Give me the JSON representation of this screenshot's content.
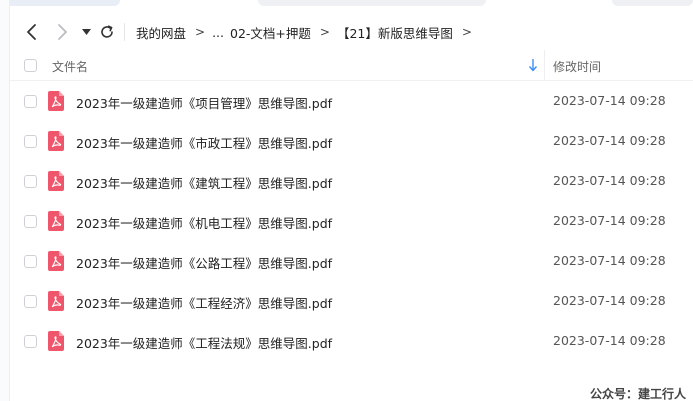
{
  "breadcrumb": {
    "items": [
      "我的网盘",
      "...",
      "02-文档+押题",
      "【21】新版思维导图"
    ],
    "separator": ">"
  },
  "table": {
    "header_name": "文件名",
    "header_date": "修改时间",
    "rows": [
      {
        "name": "2023年一级建造师《项目管理》思维导图.pdf",
        "date": "2023-07-14 09:28"
      },
      {
        "name": "2023年一级建造师《市政工程》思维导图.pdf",
        "date": "2023-07-14 09:28"
      },
      {
        "name": "2023年一级建造师《建筑工程》思维导图.pdf",
        "date": "2023-07-14 09:28"
      },
      {
        "name": "2023年一级建造师《机电工程》思维导图.pdf",
        "date": "2023-07-14 09:28"
      },
      {
        "name": "2023年一级建造师《公路工程》思维导图.pdf",
        "date": "2023-07-14 09:28"
      },
      {
        "name": "2023年一级建造师《工程经济》思维导图.pdf",
        "date": "2023-07-14 09:28"
      },
      {
        "name": "2023年一级建造师《工程法规》思维导图.pdf",
        "date": "2023-07-14 09:28"
      }
    ]
  },
  "icons": {
    "back": "chevron-left-icon",
    "forward": "chevron-right-icon",
    "dropdown": "caret-down-icon",
    "refresh": "refresh-icon",
    "sort": "arrow-down-icon",
    "file": "pdf-file-icon"
  },
  "colors": {
    "pdf_icon": "#f0566b",
    "sort_arrow": "#3b8ff5"
  },
  "watermark": "公众号：建工行人"
}
